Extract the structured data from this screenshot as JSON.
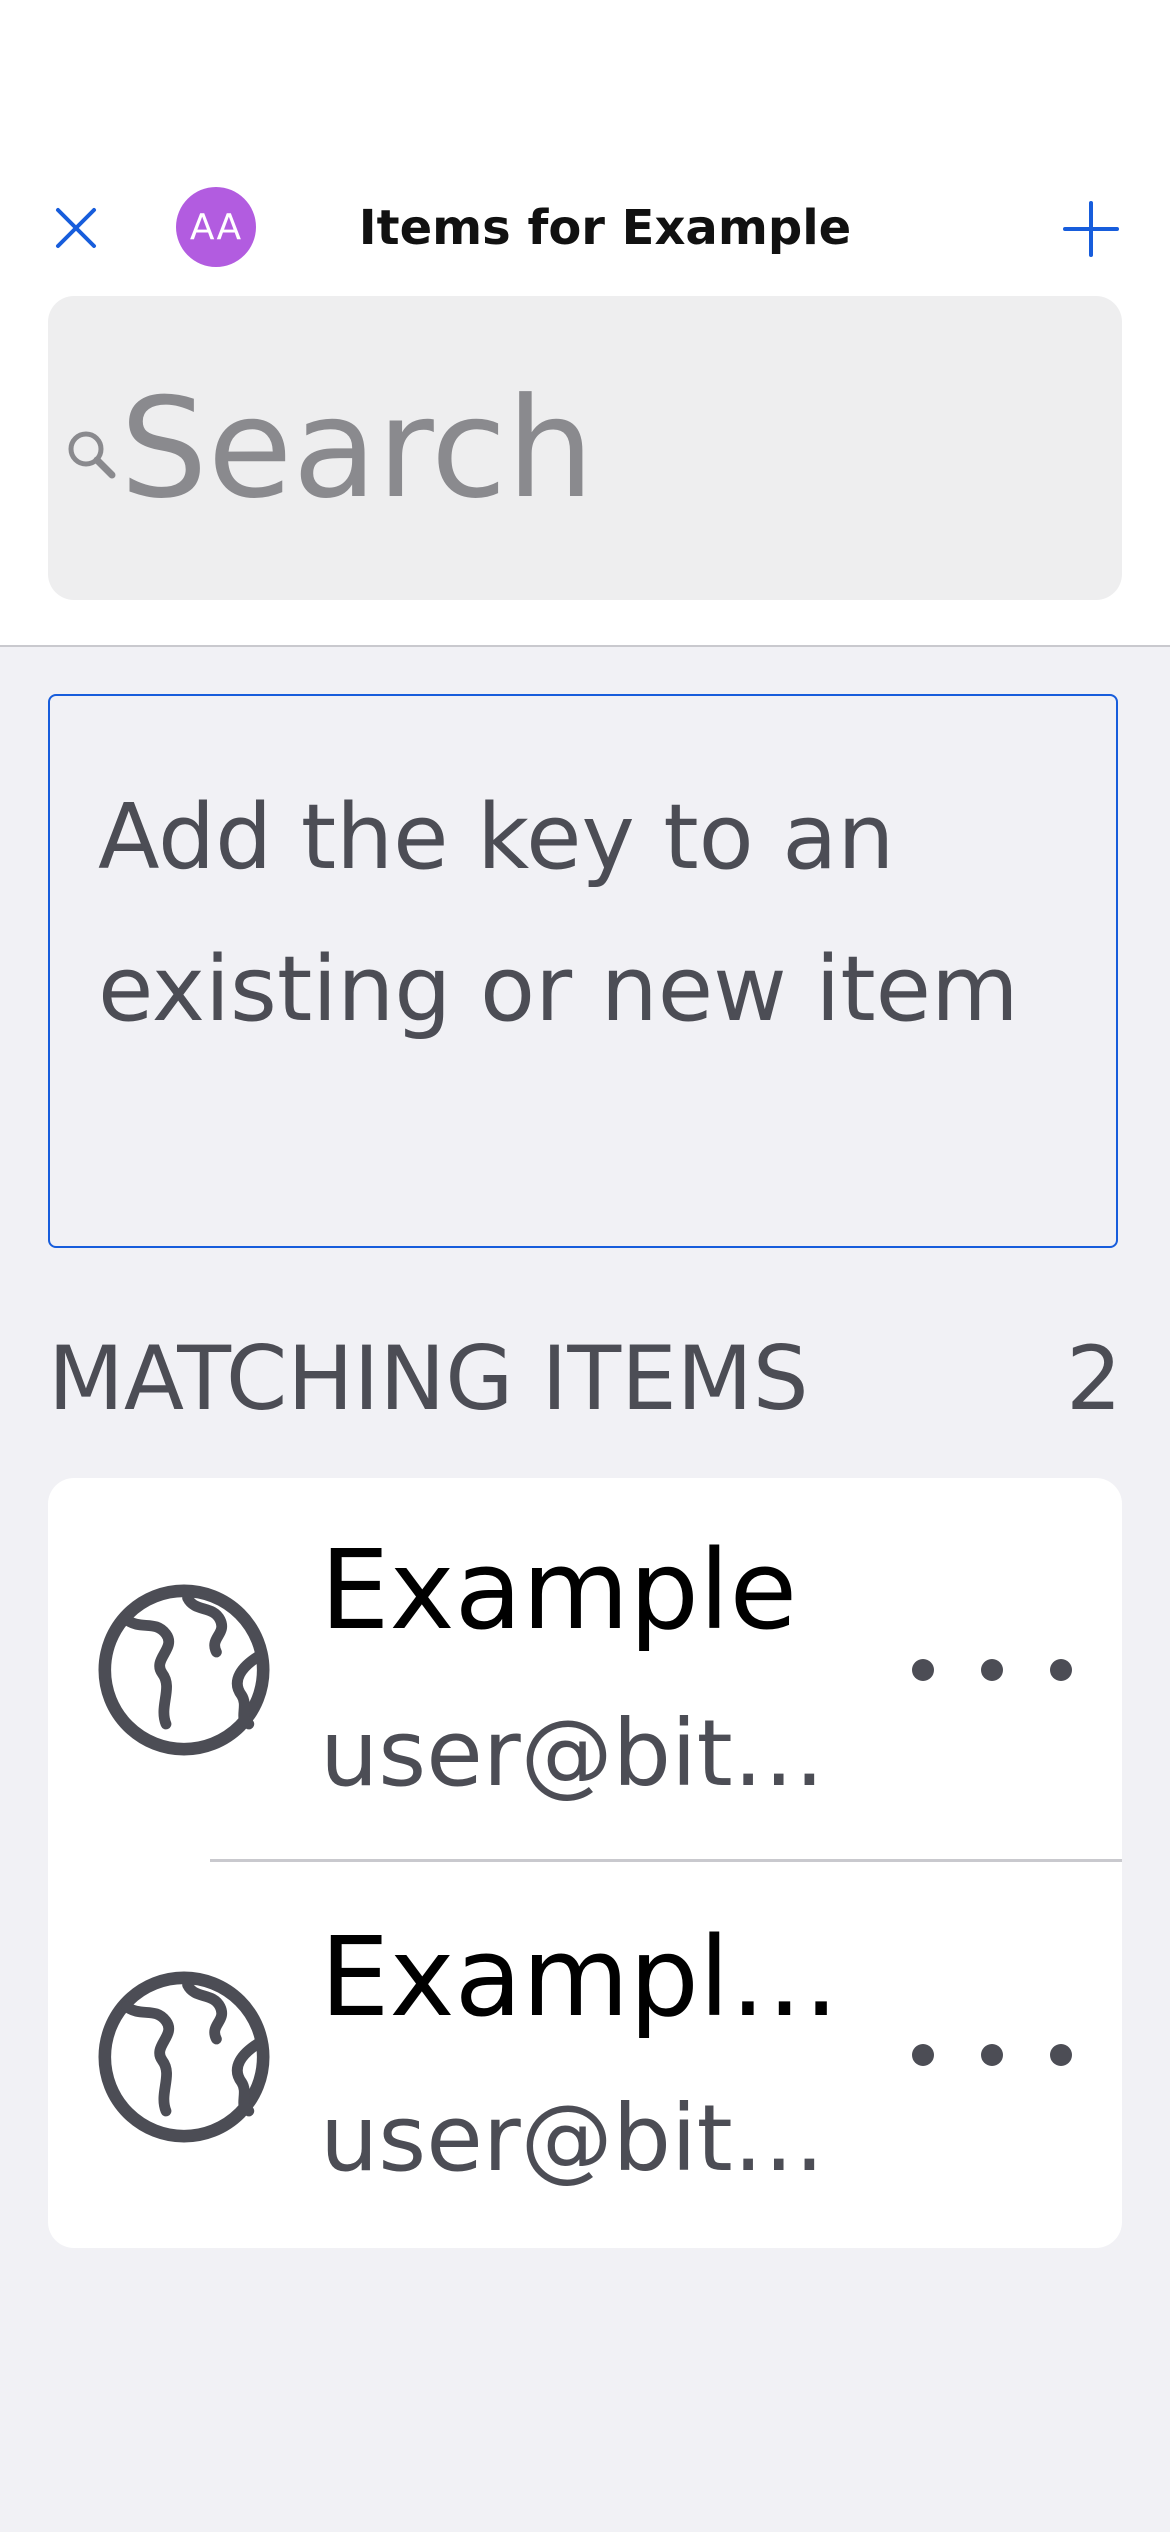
{
  "header": {
    "title": "Items for Example",
    "avatar_initials": "AA",
    "avatar_color": "#b25ce0",
    "close_icon": "close-icon",
    "add_icon": "plus-icon"
  },
  "search": {
    "placeholder": "Search",
    "icon": "search-icon"
  },
  "add_key_button": {
    "label": "Add the key to an existing or new item"
  },
  "matching": {
    "heading": "MATCHING ITEMS",
    "count": "2"
  },
  "items": [
    {
      "name": "Example",
      "username": "user@bit…",
      "icon": "globe-icon"
    },
    {
      "name": "Exampl…",
      "username": "user@bit…",
      "icon": "globe-icon"
    }
  ],
  "colors": {
    "accent": "#175ddc",
    "background": "#f1f1f5",
    "text_secondary": "#4c4d55"
  }
}
